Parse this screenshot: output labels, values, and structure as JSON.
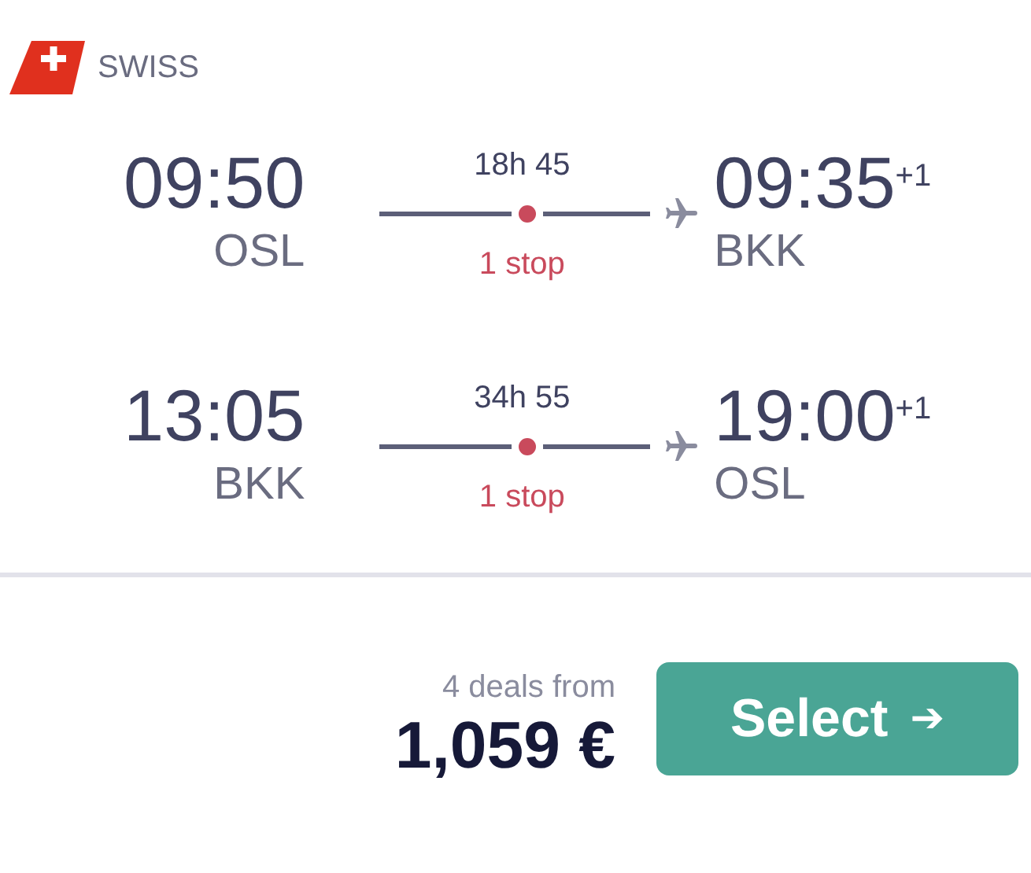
{
  "airline": {
    "name": "SWISS"
  },
  "legs": [
    {
      "depart_time": "09:50",
      "depart_airport": "OSL",
      "duration": "18h 45",
      "stops": "1 stop",
      "arrive_time": "09:35",
      "day_offset": "+1",
      "arrive_airport": "BKK"
    },
    {
      "depart_time": "13:05",
      "depart_airport": "BKK",
      "duration": "34h 55",
      "stops": "1 stop",
      "arrive_time": "19:00",
      "day_offset": "+1",
      "arrive_airport": "OSL"
    }
  ],
  "deals": "4 deals from",
  "price": "1,059 €",
  "select_button": {
    "label": "Select",
    "arrow": "➔"
  }
}
